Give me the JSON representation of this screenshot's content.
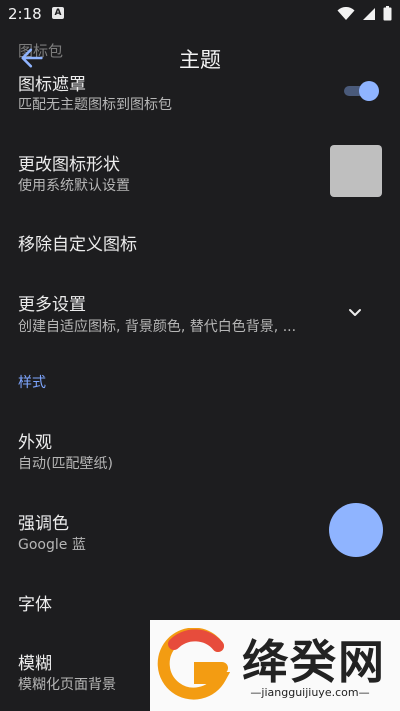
{
  "status": {
    "time": "2:18",
    "a_badge": "A"
  },
  "appbar": {
    "title": "主题",
    "ghost_text": "图标包"
  },
  "rows": {
    "icon_mask": {
      "title": "图标遮罩",
      "subtitle": "匹配无主题图标到图标包",
      "enabled": true
    },
    "icon_shape": {
      "title": "更改图标形状",
      "subtitle": "使用系统默认设置"
    },
    "remove_custom": {
      "title": "移除自定义图标"
    },
    "more_settings": {
      "title": "更多设置",
      "subtitle": "创建自适应图标, 背景颜色, 替代白色背景, ..."
    },
    "appearance": {
      "title": "外观",
      "subtitle": "自动(匹配壁纸)"
    },
    "accent": {
      "title": "强调色",
      "subtitle": "Google 蓝"
    },
    "font": {
      "title": "字体"
    },
    "blur": {
      "title": "模糊",
      "subtitle": "模糊化页面背景"
    }
  },
  "sections": {
    "style": "样式"
  },
  "colors": {
    "background": "#1d1d1f",
    "accent": "#7ea6ff",
    "accent_swatch": "#8fb4ff"
  },
  "watermark": {
    "brand": "绛癸网",
    "url": "—jiangguijiuye.com—"
  }
}
